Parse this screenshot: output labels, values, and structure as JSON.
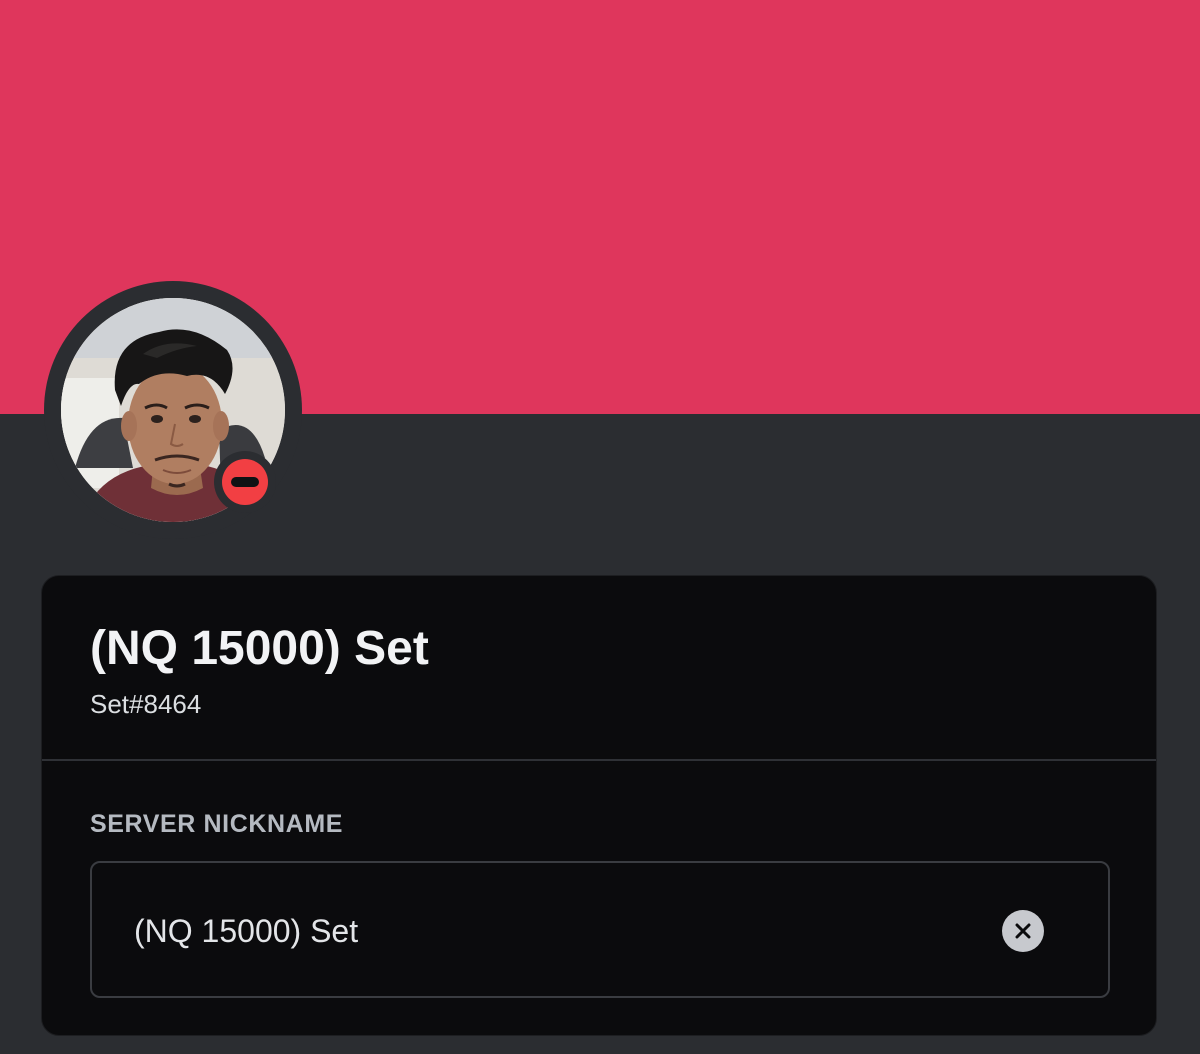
{
  "profile": {
    "banner_color": "#df365c",
    "avatar_icon": "user-avatar-photo",
    "status": "do-not-disturb",
    "status_color": "#f23f43",
    "display_name": "(NQ 15000) Set",
    "username": "Set#8464"
  },
  "server_nickname": {
    "label": "SERVER NICKNAME",
    "value": "(NQ 15000) Set",
    "clear_icon": "close-circle-icon"
  },
  "colors": {
    "background": "#2b2d31",
    "card": "#0b0b0d",
    "text_primary": "#f2f3f5",
    "text_muted": "#b5bac1"
  }
}
